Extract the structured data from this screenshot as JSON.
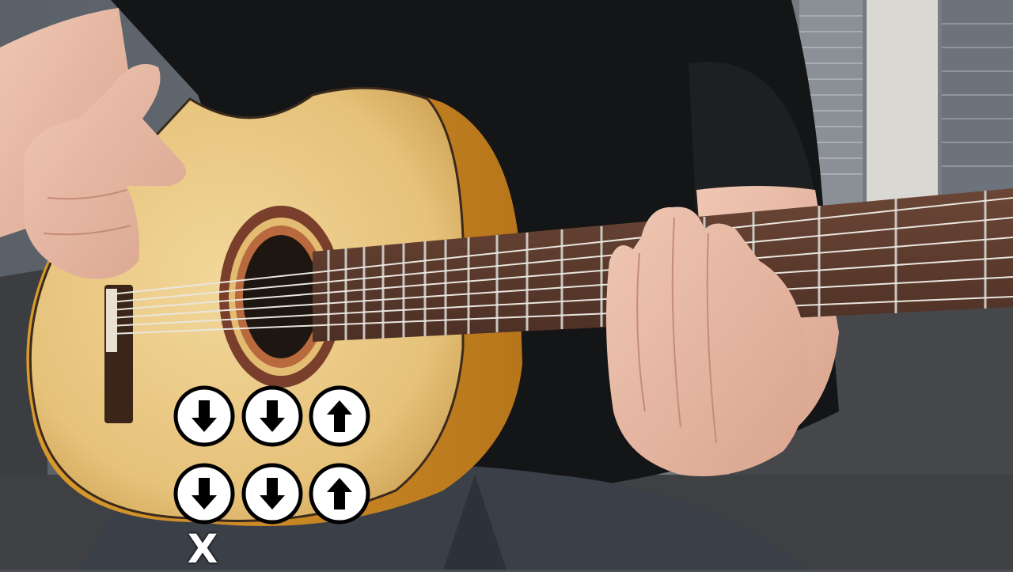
{
  "scene": {
    "description_icon": "guitar-strumming-photo"
  },
  "strum_pattern": {
    "rows": [
      [
        "down",
        "down",
        "up"
      ],
      [
        "down",
        "down",
        "up"
      ]
    ],
    "mute_marker": "X",
    "arrow_color": "#000000",
    "circle_fill": "#ffffff"
  }
}
